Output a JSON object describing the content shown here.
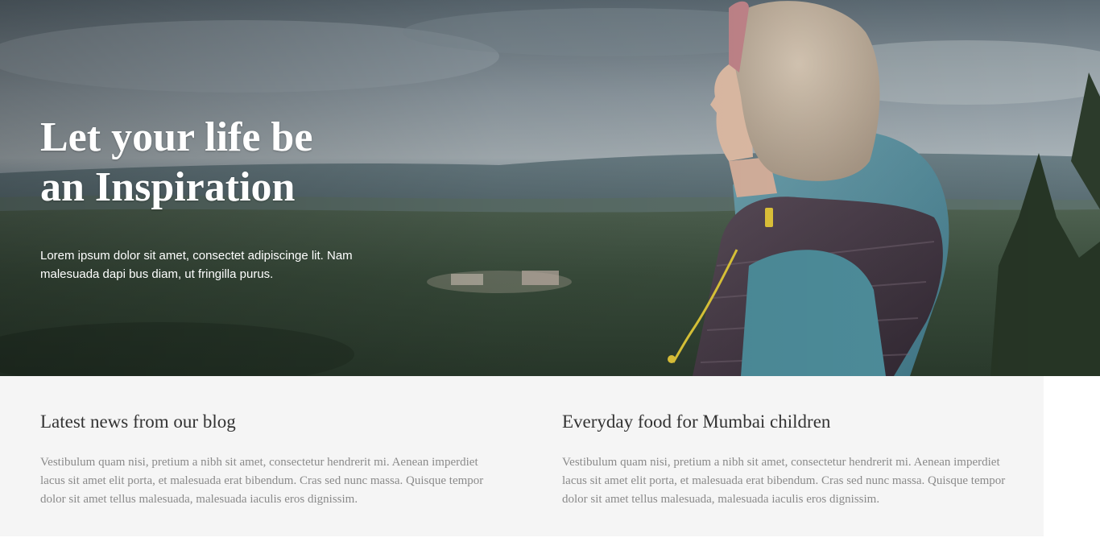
{
  "hero": {
    "title_line1": "Let your life be",
    "title_line2": "an Inspiration",
    "description": "Lorem ipsum dolor sit amet, consectet adipiscinge lit. Nam malesuada dapi bus diam, ut fringilla purus."
  },
  "articles": [
    {
      "title": "Latest news from our blog",
      "body": "Vestibulum quam nisi, pretium a nibh sit amet, consectetur hendrerit mi. Aenean imperdiet lacus sit amet elit porta, et malesuada erat bibendum. Cras sed nunc massa. Quisque tempor dolor sit amet tellus malesuada, malesuada iaculis eros dignissim."
    },
    {
      "title": "Everyday food for Mumbai children",
      "body": "Vestibulum quam nisi, pretium a nibh sit amet, consectetur hendrerit mi. Aenean imperdiet lacus sit amet elit porta, et malesuada erat bibendum. Cras sed nunc massa. Quisque tempor dolor sit amet tellus malesuada, malesuada iaculis eros dignissim."
    }
  ],
  "colors": {
    "content_background": "#f5f5f5",
    "article_title": "#333333",
    "article_body": "#8a8a8a",
    "hero_text": "#ffffff"
  }
}
